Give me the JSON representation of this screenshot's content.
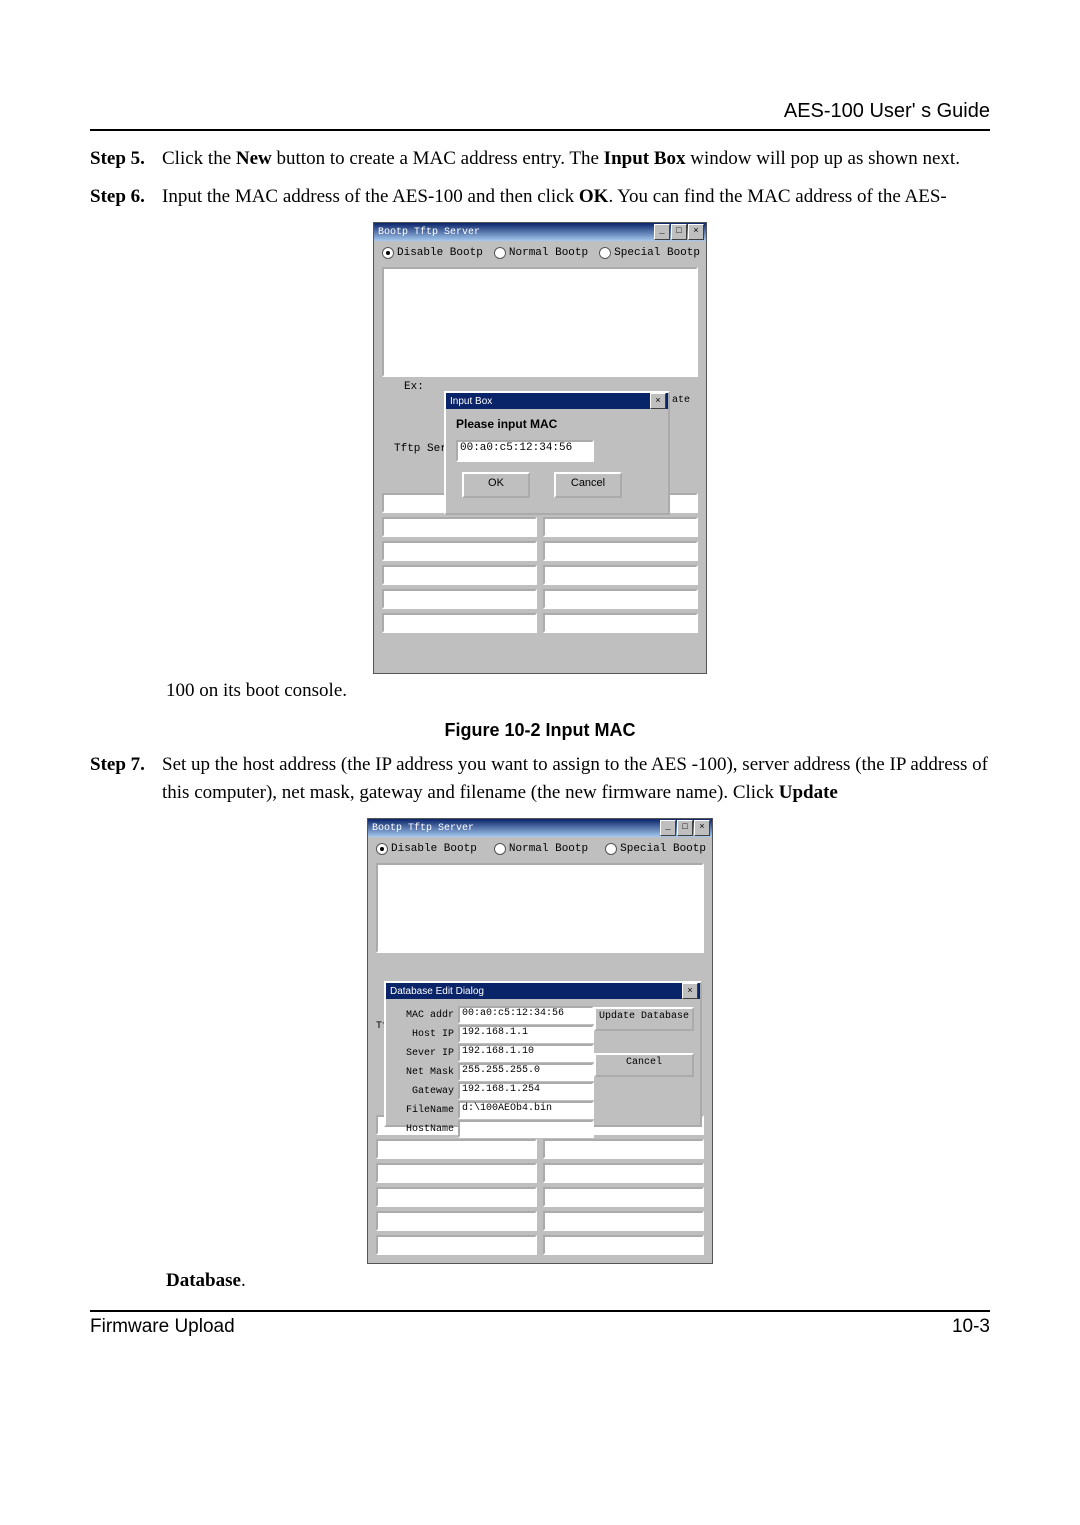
{
  "header": {
    "guide_title": "AES-100 User' s Guide"
  },
  "steps": {
    "s5": {
      "label": "Step 5.",
      "t1": "Click the ",
      "new": "New",
      "t2": " button to create a MAC address entry. The ",
      "ib": "Input Box",
      "t3": " window will pop up as shown next."
    },
    "s6": {
      "label": "Step 6.",
      "t1": "Input the MAC address of the AES-100 and then click ",
      "ok": "OK",
      "t2": ". You can find the MAC address of the AES-"
    },
    "cont6": "100 on its boot console.",
    "s7": {
      "label": "Step 7.",
      "t1": "Set up the host address (the IP address you want to assign to the AES -100), server address (the IP address of this computer), net mask, gateway and filename (the new firmware name). Click ",
      "upd": "Update"
    }
  },
  "fig1_caption": "Figure 10-2 Input MAC",
  "win1": {
    "title": "Bootp Tftp Server",
    "radios": {
      "disable": "Disable Bootp",
      "normal": "Normal Bootp",
      "special": "Special Bootp"
    },
    "ex": "Ex:",
    "tftp_serv": "Tftp Serv",
    "ate": "ate"
  },
  "dialog1": {
    "title": "Input Box",
    "label": "Please input MAC",
    "value": "00:a0:c5:12:34:56",
    "ok": "OK",
    "cancel": "Cancel"
  },
  "win2": {
    "title": "Bootp Tftp Server",
    "radios": {
      "disable": "Disable Bootp",
      "normal": "Normal Bootp",
      "special": "Special Bootp"
    },
    "tf": "Tf"
  },
  "dialog2": {
    "title": "Database Edit Dialog",
    "fields": {
      "mac_label": "MAC addr",
      "mac_val": "00:a0:c5:12:34:56",
      "host_label": "Host  IP",
      "host_val": "192.168.1.1",
      "sever_label": "Sever IP",
      "sever_val": "192.168.1.10",
      "mask_label": "Net Mask",
      "mask_val": "255.255.255.0",
      "gw_label": "Gateway",
      "gw_val": "192.168.1.254",
      "file_label": "FileName",
      "file_val": "d:\\100AEOb4.bin",
      "hostn_label": "HostName",
      "hostn_val": ""
    },
    "update": "Update Database",
    "cancel": "Cancel"
  },
  "database_line": "Database",
  "footer": {
    "left": "Firmware Upload",
    "right": "10-3"
  }
}
